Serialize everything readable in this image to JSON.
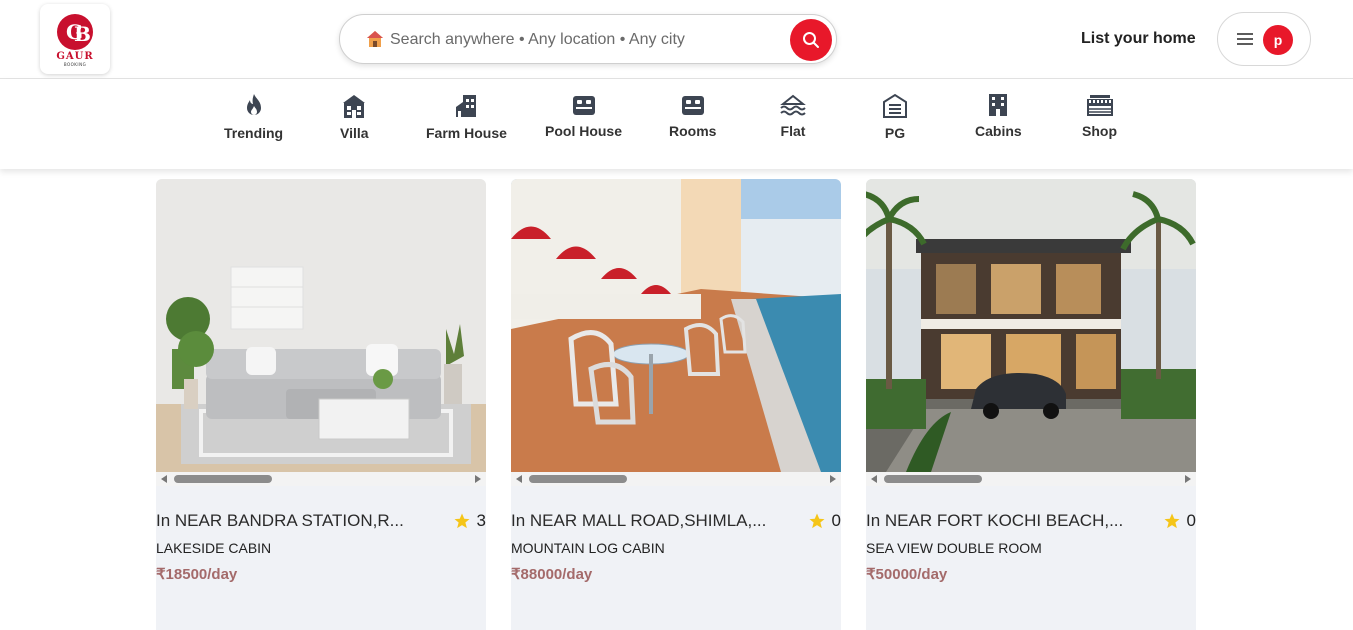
{
  "brand": {
    "logo_text": "GAUR",
    "logo_sub": "BOOKING",
    "accent": "#e8182a"
  },
  "search": {
    "placeholder": "Search anywhere • Any location • Any city",
    "icon": "search-icon",
    "emoji": "house-icon"
  },
  "header": {
    "list_home_label": "List your home",
    "avatar_letter": "p",
    "menu_icon": "hamburger-icon"
  },
  "categories": [
    {
      "label": "Trending",
      "icon": "fire-icon"
    },
    {
      "label": "Villa",
      "icon": "villa-icon"
    },
    {
      "label": "Farm House",
      "icon": "farm-house-icon"
    },
    {
      "label": "Pool House",
      "icon": "pool-house-icon"
    },
    {
      "label": "Rooms",
      "icon": "bed-icon"
    },
    {
      "label": "Flat",
      "icon": "flat-icon"
    },
    {
      "label": "PG",
      "icon": "pg-icon"
    },
    {
      "label": "Cabins",
      "icon": "building-icon"
    },
    {
      "label": "Shop",
      "icon": "shop-icon"
    }
  ],
  "listings": [
    {
      "title": "In NEAR BANDRA STATION,R...",
      "rating": "3",
      "type": "LAKESIDE CABIN",
      "price": "₹18500/day"
    },
    {
      "title": "In NEAR MALL ROAD,SHIMLA,...",
      "rating": "0",
      "type": "MOUNTAIN LOG CABIN",
      "price": "₹88000/day"
    },
    {
      "title": "In NEAR FORT KOCHI BEACH,...",
      "rating": "0",
      "type": "SEA VIEW DOUBLE ROOM",
      "price": "₹50000/day"
    }
  ]
}
